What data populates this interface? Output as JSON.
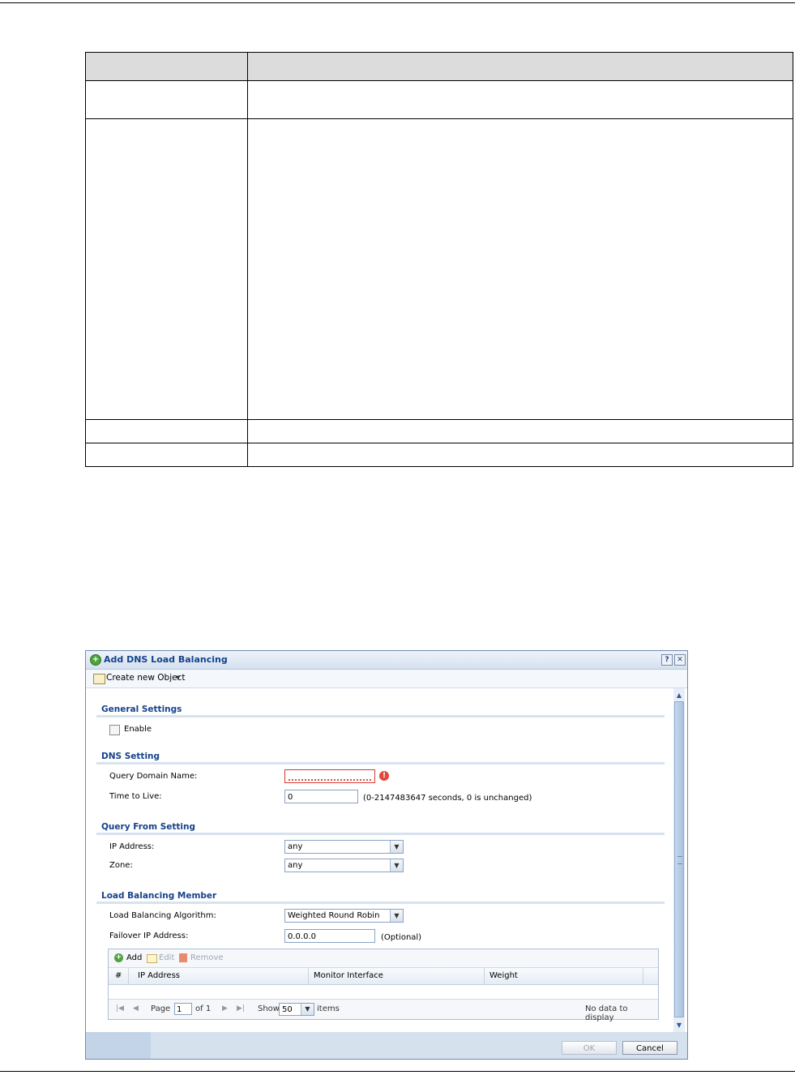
{
  "dialog": {
    "title": "Add DNS Load Balancing",
    "help": "?",
    "close": "✕",
    "toolbar": {
      "create_new_object": "Create new Object"
    },
    "general_settings": {
      "title": "General Settings",
      "enable_label": "Enable"
    },
    "dns_setting": {
      "title": "DNS Setting",
      "query_domain_name_label": "Query Domain Name:",
      "query_domain_name_value": "",
      "time_to_live_label": "Time to Live:",
      "time_to_live_value": "0",
      "time_to_live_hint": "(0-2147483647 seconds, 0 is unchanged)"
    },
    "query_from_setting": {
      "title": "Query From Setting",
      "ip_address_label": "IP Address:",
      "ip_address_value": "any",
      "zone_label": "Zone:",
      "zone_value": "any"
    },
    "load_balancing_member": {
      "title": "Load Balancing Member",
      "algorithm_label": "Load Balancing Algorithm:",
      "algorithm_value": "Weighted Round Robin",
      "failover_label": "Failover IP Address:",
      "failover_value": "0.0.0.0",
      "failover_hint": "(Optional)",
      "grid": {
        "toolbar": {
          "add": "Add",
          "edit": "Edit",
          "remove": "Remove"
        },
        "columns": [
          "#",
          "IP Address",
          "Monitor Interface",
          "Weight"
        ],
        "footer": {
          "page_label": "Page",
          "page_value": "1",
          "of_label": "of 1",
          "show_label": "Show",
          "show_value": "50",
          "items_label": "items",
          "no_data": "No data to display"
        }
      }
    },
    "buttons": {
      "ok": "OK",
      "cancel": "Cancel"
    }
  }
}
